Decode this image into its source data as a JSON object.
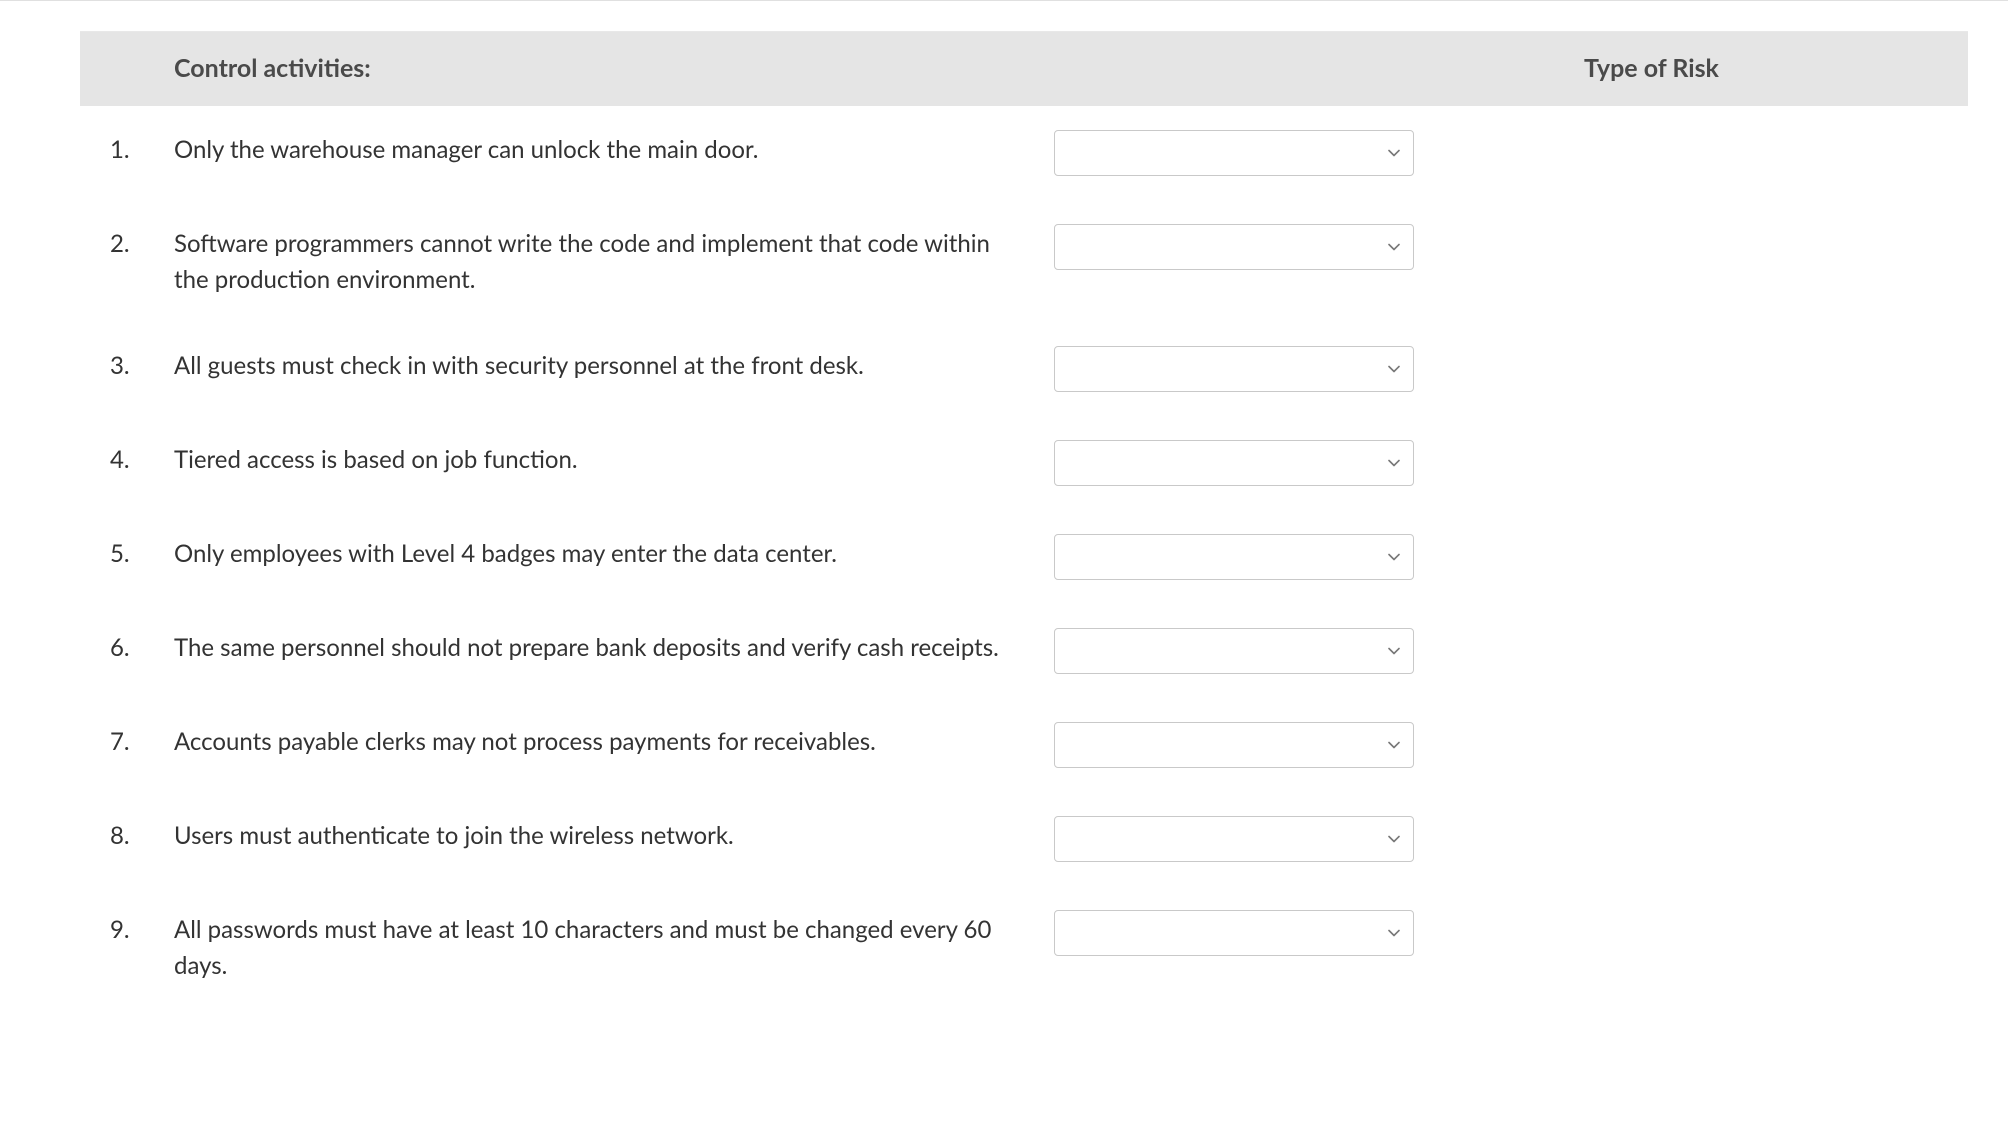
{
  "header": {
    "col_activity_label": "Control activities:",
    "col_risk_label": "Type of Risk"
  },
  "rows": [
    {
      "number": "1.",
      "activity": "Only the warehouse manager can unlock the main door.",
      "risk_value": ""
    },
    {
      "number": "2.",
      "activity": "Software programmers cannot write the code and implement that code within the production environment.",
      "risk_value": ""
    },
    {
      "number": "3.",
      "activity": "All guests must check in with security personnel at the front desk.",
      "risk_value": ""
    },
    {
      "number": "4.",
      "activity": "Tiered access is based on job function.",
      "risk_value": ""
    },
    {
      "number": "5.",
      "activity": "Only employees with Level 4 badges may enter the data center.",
      "risk_value": ""
    },
    {
      "number": "6.",
      "activity": "The same personnel should not prepare bank deposits and verify cash receipts.",
      "risk_value": ""
    },
    {
      "number": "7.",
      "activity": "Accounts payable clerks may not process payments for receivables.",
      "risk_value": ""
    },
    {
      "number": "8.",
      "activity": "Users must authenticate to join the wireless network.",
      "risk_value": ""
    },
    {
      "number": "9.",
      "activity": "All passwords must have at least 10 characters and must be changed every 60 days.",
      "risk_value": ""
    }
  ]
}
